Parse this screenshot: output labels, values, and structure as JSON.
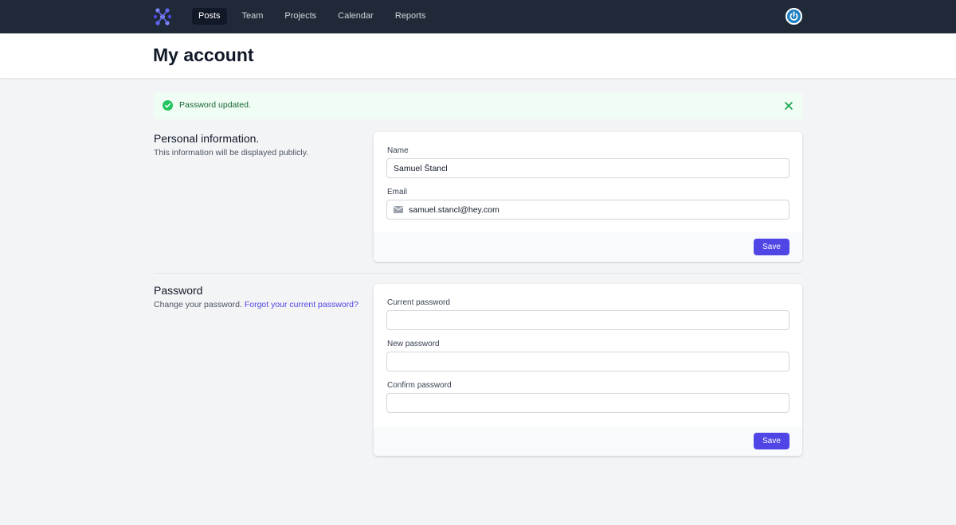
{
  "nav": {
    "logo": "app-logo",
    "items": [
      {
        "label": "Posts",
        "active": true
      },
      {
        "label": "Team",
        "active": false
      },
      {
        "label": "Projects",
        "active": false
      },
      {
        "label": "Calendar",
        "active": false
      },
      {
        "label": "Reports",
        "active": false
      }
    ],
    "avatar_icon": "power-icon"
  },
  "header": {
    "title": "My account"
  },
  "alert": {
    "message": "Password updated.",
    "icon": "check-circle-icon",
    "close_icon": "close-icon",
    "color": "#166534"
  },
  "personal": {
    "title": "Personal information.",
    "description": "This information will be displayed publicly.",
    "name_label": "Name",
    "name_value": "Samuel Štancl",
    "email_label": "Email",
    "email_value": "samuel.stancl@hey.com",
    "email_icon": "mail-icon",
    "save_label": "Save"
  },
  "password": {
    "title": "Password",
    "description": "Change your password.",
    "forgot_link": "Forgot your current password?",
    "current_label": "Current password",
    "current_value": "",
    "new_label": "New password",
    "new_value": "",
    "confirm_label": "Confirm password",
    "confirm_value": "",
    "save_label": "Save"
  },
  "colors": {
    "nav_bg": "#1f2937",
    "accent": "#4f46e5",
    "success": "#22c55e",
    "page_bg": "#f3f4f6"
  }
}
